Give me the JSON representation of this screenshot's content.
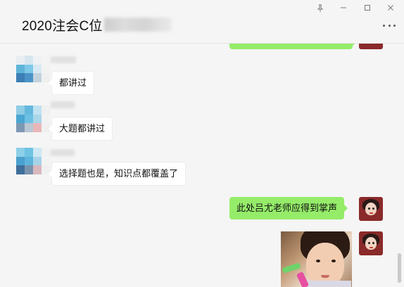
{
  "window": {
    "title": "2020注会C位",
    "pin_icon": "pin-icon",
    "minimize_icon": "minimize-icon",
    "maximize_icon": "maximize-icon",
    "close_icon": "close-icon",
    "more_icon": "more-dots-icon"
  },
  "messages": [
    {
      "direction": "out",
      "text": "",
      "partial": true
    },
    {
      "direction": "in",
      "text": "都讲过"
    },
    {
      "direction": "in",
      "text": "大题都讲过"
    },
    {
      "direction": "in",
      "text": "选择题也是，知识点都覆盖了"
    },
    {
      "direction": "out",
      "text": "此处吕尤老师应得到掌声"
    },
    {
      "direction": "out",
      "type": "image"
    }
  ],
  "colors": {
    "outgoing_bubble": "#95ec69",
    "incoming_bubble": "#ffffff",
    "background": "#f5f5f5"
  }
}
